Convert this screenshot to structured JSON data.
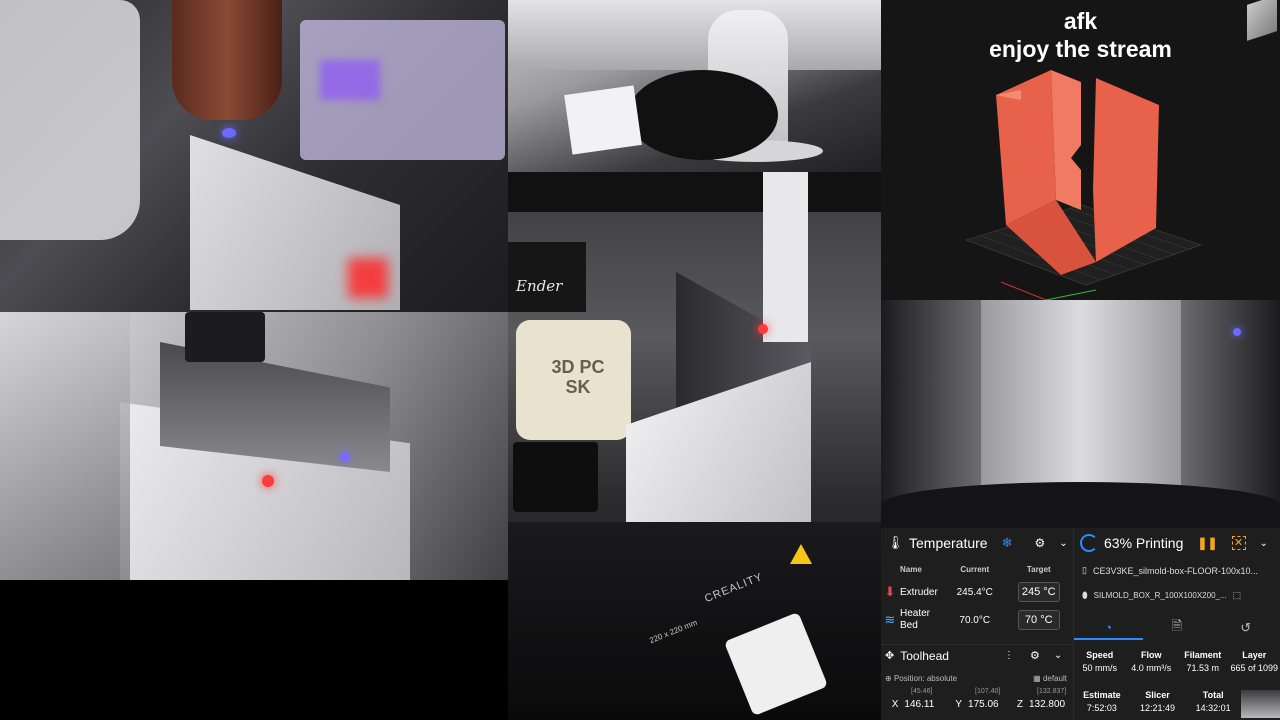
{
  "overlay": {
    "line1": "afk",
    "line2": "enjoy the stream"
  },
  "cameras": {
    "printer_brand": "Ender",
    "bed_brand": "CREALITY",
    "bed_size": "220 x 220 mm",
    "fan_shroud_text": "3D PC SK"
  },
  "temperature": {
    "title": "Temperature",
    "columns": [
      "Name",
      "Current",
      "Target"
    ],
    "rows": [
      {
        "name": "Extruder",
        "current": "245.4°C",
        "target": "245",
        "unit": "°C"
      },
      {
        "name": "Heater Bed",
        "current": "70.0°C",
        "target": "70",
        "unit": "°C"
      }
    ]
  },
  "toolhead": {
    "title": "Toolhead",
    "position_label": "Position: absolute",
    "profile_label": "default",
    "axes": [
      {
        "axis": "X",
        "value": "146.11",
        "requested": "[45.46]"
      },
      {
        "axis": "Y",
        "value": "175.06",
        "requested": "[107.40]"
      },
      {
        "axis": "Z",
        "value": "132.800",
        "requested": "[132.837]"
      }
    ]
  },
  "status": {
    "title": "63% Printing",
    "progress_percent": 63,
    "file1": "CE3V3KE_silmold-box-FLOOR-100x10...",
    "file2": "SILMOLD_BOX_R_100X100X200_...",
    "stats1": [
      {
        "label": "Speed",
        "value": "50 mm/s"
      },
      {
        "label": "Flow",
        "value": "4.0 mm³/s"
      },
      {
        "label": "Filament",
        "value": "71.53 m"
      },
      {
        "label": "Layer",
        "value": "665 of 1099"
      }
    ],
    "stats2": [
      {
        "label": "Estimate",
        "value": "7:52:03"
      },
      {
        "label": "Slicer",
        "value": "12:21:49"
      },
      {
        "label": "Total",
        "value": "14:32:01"
      }
    ]
  },
  "colors": {
    "accent": "#2b8cff",
    "warning": "#f5a623",
    "model": "#e8614a",
    "extruder_icon": "#e84a4a",
    "bed_icon": "#4aa8ff"
  }
}
